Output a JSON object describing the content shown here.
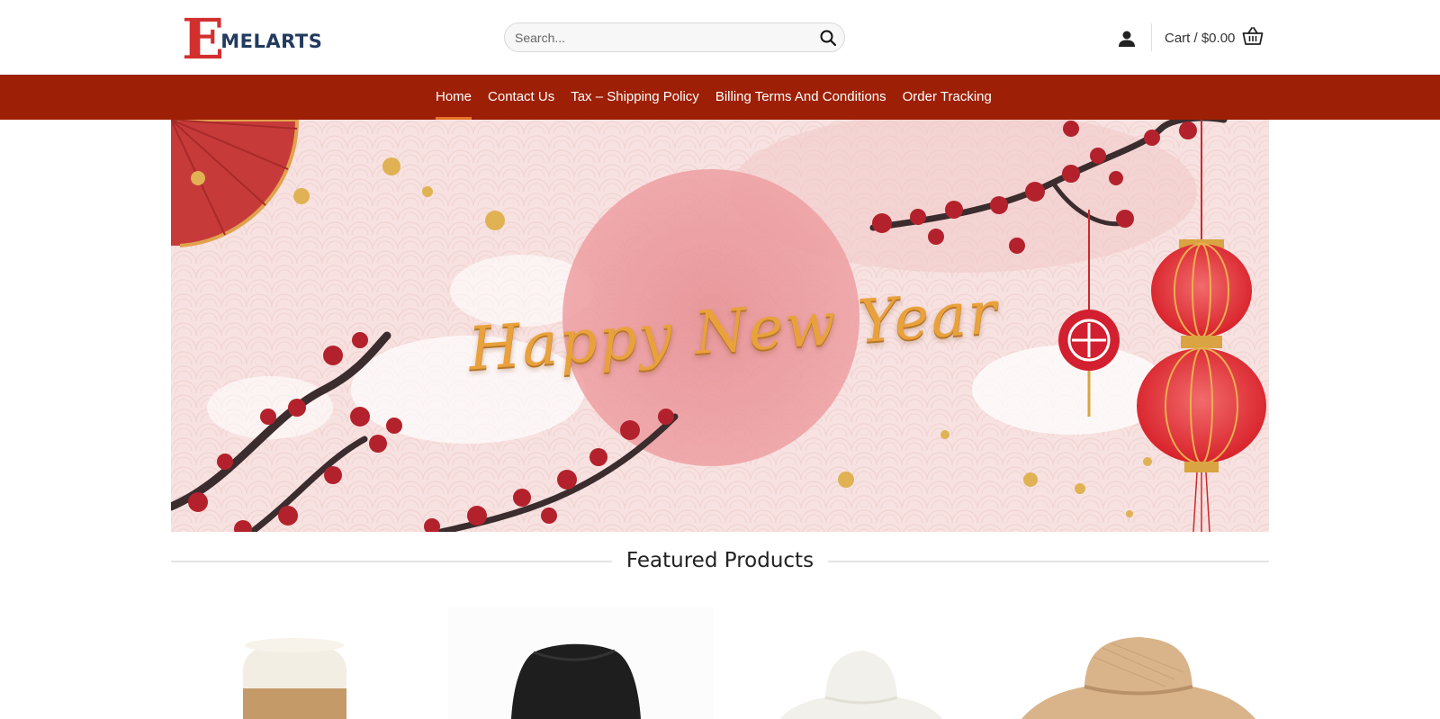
{
  "site": {
    "logo_letter": "E",
    "logo_text": "MELARTS"
  },
  "header": {
    "search_placeholder": "Search...",
    "cart_label": "Cart / $0.00",
    "icons": {
      "search": "search-icon",
      "account": "user-icon",
      "cart": "basket-icon"
    }
  },
  "nav": {
    "items": [
      {
        "label": "Home",
        "active": true
      },
      {
        "label": "Contact Us",
        "active": false
      },
      {
        "label": "Tax – Shipping Policy",
        "active": false
      },
      {
        "label": "Billing Terms And Conditions",
        "active": false
      },
      {
        "label": "Order Tracking",
        "active": false
      }
    ]
  },
  "banner": {
    "headline": "Happy New Year"
  },
  "featured": {
    "title": "Featured Products"
  },
  "colors": {
    "nav_bg": "#9d2006",
    "active_underline": "#e8742a",
    "logo_red": "#d32f2f",
    "logo_navy": "#233a5e",
    "banner_gold": "#e9a13c"
  }
}
